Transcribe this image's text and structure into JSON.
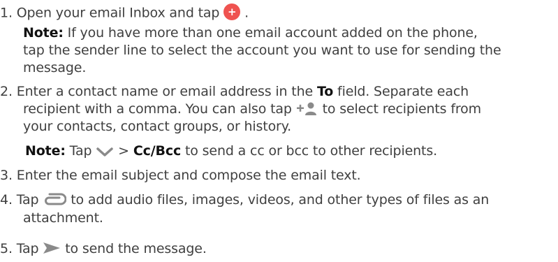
{
  "steps": [
    {
      "number": "1.",
      "line1_before": "Open your email Inbox and tap",
      "line1_after": ".",
      "note_label": "Note:",
      "note_line1": "If you have more than one email account added on the phone,",
      "note_line2": "tap the sender line to select the account you want to use for sending the",
      "note_line3": "message."
    },
    {
      "number": "2.",
      "line1_before": "Enter a contact name or email address in the",
      "to_label": "To",
      "line1_after": "field. Separate each",
      "line2_before": "recipient with a comma. You can also tap",
      "line2_after": "to select recipients from",
      "line3": "your contacts, contact groups, or history.",
      "note_label": "Note:",
      "note_tap": "Tap",
      "note_gt": ">",
      "note_ccbcc": "Cc/Bcc",
      "note_after": "to send a cc or bcc to other recipients."
    },
    {
      "number": "3.",
      "text": "Enter the email subject and compose the email text."
    },
    {
      "number": "4.",
      "line1_before": "Tap",
      "line1_after": "to add audio files, images, videos, and other types of files as an",
      "line2": "attachment."
    },
    {
      "number": "5.",
      "before": "Tap",
      "after": "to send the message."
    }
  ],
  "icons": {
    "compose": "compose-plus-icon",
    "add_contact": "add-contact-icon",
    "expand": "chevron-down-icon",
    "attach": "attachment-icon",
    "send": "send-icon"
  },
  "colors": {
    "compose_button": "#ef5350",
    "icon_gray": "#8a8a8a",
    "text": "#3f3f3f"
  }
}
